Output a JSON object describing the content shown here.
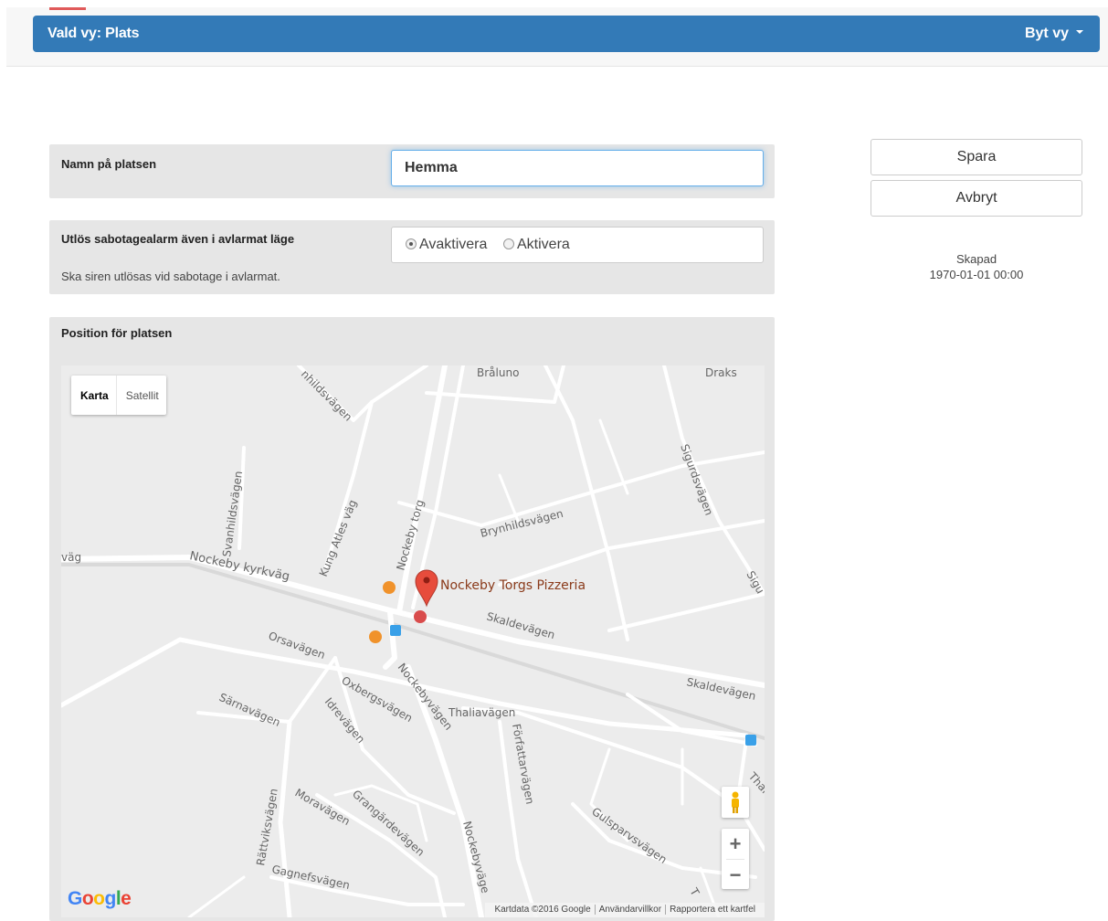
{
  "header": {
    "title": "Vald vy: Plats",
    "switch_view": "Byt vy"
  },
  "form": {
    "name": {
      "label": "Namn på platsen",
      "value": "Hemma"
    },
    "sabotage": {
      "label": "Utlös sabotagealarm även i avlarmat läge",
      "help": "Ska siren utlösas vid sabotage i avlarmat.",
      "options": [
        "Avaktivera",
        "Aktivera"
      ],
      "selected": "Avaktivera"
    },
    "position": {
      "label": "Position för platsen"
    }
  },
  "map": {
    "type_buttons": [
      "Karta",
      "Satellit"
    ],
    "active_type": "Karta",
    "marker_label": "Nockeby Torgs Pizzeria",
    "google_logo": "Google",
    "zoom_in": "+",
    "zoom_out": "−",
    "attribution": [
      "Kartdata ©2016 Google",
      "Användarvillkor",
      "Rapportera ett kartfel"
    ],
    "streets": [
      "Bråluno",
      "Draks",
      "nhildsvägen",
      "Svanhildsvägen",
      "Kung Atles väg",
      "Nockeby torg",
      "Sigurdsvägen",
      "Brynhildsvägen",
      "väg",
      "Nockeby kyrkväg",
      "Sigu",
      "Skaldevägen",
      "Orsavägen",
      "Skaldevägen",
      "Oxbergsvägen",
      "Nockebyvägen",
      "Thaliavägen",
      "Särnavägen",
      "Idrevägen",
      "Författarvägen",
      "Thal",
      "Moravägen",
      "Grangärdevägen",
      "Rättviksvägen",
      "Gulsparvsvägen",
      "Gagnefsvägen",
      "Nockebyväge",
      "T"
    ]
  },
  "actions": {
    "save": "Spara",
    "cancel": "Avbryt"
  },
  "meta": {
    "created_label": "Skapad",
    "created_value": "1970-01-01 00:00"
  },
  "colors": {
    "header": "#337ab7",
    "panel": "#e6e6e6",
    "marker": "#e74c3c",
    "map_bg": "#ececec"
  }
}
